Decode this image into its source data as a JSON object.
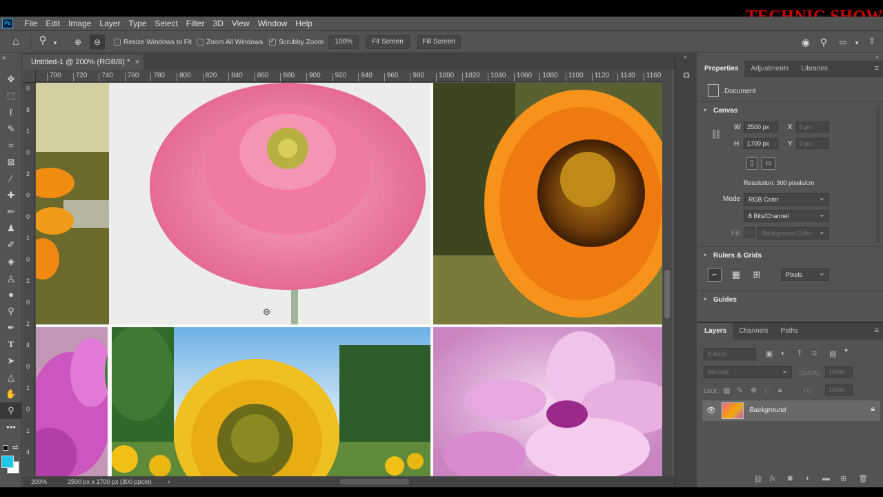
{
  "watermark": "TECHNIC SHOW",
  "menubar": {
    "logo": "Ps",
    "items": [
      "File",
      "Edit",
      "Image",
      "Layer",
      "Type",
      "Select",
      "Filter",
      "3D",
      "View",
      "Window",
      "Help"
    ]
  },
  "options": {
    "resize_windows": "Resize Windows to Fit",
    "zoom_all": "Zoom All Windows",
    "scrubby": "Scrubby Zoom",
    "zoom_value": "100%",
    "fit_screen": "Fit Screen",
    "fill_screen": "Fill Screen"
  },
  "document": {
    "tab_title": "Untitled-1 @ 200% (RGB/8) *",
    "close": "×"
  },
  "ruler": {
    "h_labels": [
      "700",
      "720",
      "740",
      "760",
      "780",
      "800",
      "820",
      "840",
      "860",
      "880",
      "900",
      "920",
      "940",
      "960",
      "980",
      "1000",
      "1020",
      "1040",
      "1060",
      "1080",
      "1100",
      "1120",
      "1140",
      "1160"
    ],
    "v_labels": [
      "0",
      "8",
      "1",
      "0",
      "2",
      "0",
      "0",
      "1",
      "0",
      "2",
      "0",
      "2",
      "4",
      "0",
      "1",
      "0",
      "1",
      "4"
    ]
  },
  "status": {
    "zoom": "200%",
    "info": "2500 px x 1700 px (300 ppcm)",
    "arrow": "›"
  },
  "properties": {
    "tabs": [
      "Properties",
      "Adjustments",
      "Libraries"
    ],
    "document_label": "Document",
    "canvas_title": "Canvas",
    "w_label": "W",
    "w_value": "2500 px",
    "h_label": "H",
    "h_value": "1700 px",
    "x_label": "X",
    "x_value": "0 px",
    "y_label": "Y",
    "y_value": "0 px",
    "resolution": "Resolution: 300 pixels/cm",
    "mode_label": "Mode",
    "mode_value": "RGB Color",
    "bits_value": "8 Bits/Channel",
    "fill_label": "Fill",
    "fill_value": "Background Color",
    "rulers_title": "Rulers & Grids",
    "units_value": "Pixels",
    "guides_title": "Guides"
  },
  "layers": {
    "tabs": [
      "Layers",
      "Channels",
      "Paths"
    ],
    "kind_placeholder": "Kind",
    "blend_mode": "Normal",
    "opacity_label": "Opacity:",
    "opacity_value": "100%",
    "lock_label": "Lock:",
    "fill_label": "Fill:",
    "fill_value": "100%",
    "layer_name": "Background"
  },
  "colors": {
    "foreground": "#1ec8e8",
    "background": "#ffffff",
    "accent": "#31a8ff",
    "watermark": "#d00000"
  }
}
